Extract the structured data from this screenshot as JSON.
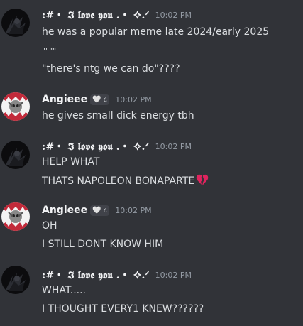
{
  "messages": [
    {
      "author": ":#・ 𝕴 𝖑𝖔𝖛𝖊 𝖞𝖔𝖚 .・ ✧.ᐟ",
      "time": "10:02 PM",
      "lines": [
        "he was a popular meme late 2024/early 2025",
        "\"\"\"\"",
        "\"there's ntg we can do\"????"
      ]
    },
    {
      "author": "Angieee",
      "badge": "🤍 ૮ ",
      "time": "10:02 PM",
      "lines": [
        "he gives small dick energy tbh"
      ]
    },
    {
      "author": ":#・ 𝕴 𝖑𝖔𝖛𝖊 𝖞𝖔𝖚 .・ ✧.ᐟ",
      "time": "10:02 PM",
      "lines": [
        "HELP WHAT",
        "THATS NAPOLEON BONAPARTE"
      ],
      "emoji": "broken-heart-icon"
    },
    {
      "author": "Angieee",
      "badge": "🤍 ૮ ",
      "time": "10:02 PM",
      "lines": [
        "OH",
        "I STILL DONT KNOW HIM"
      ]
    },
    {
      "author": ":#・ 𝕴 𝖑𝖔𝖛𝖊 𝖞𝖔𝖚 .・ ✧.ᐟ",
      "time": "10:02 PM",
      "lines": [
        "WHAT.....",
        "I THOUGHT EVERY1 KNEW??????"
      ]
    }
  ],
  "colors": {
    "background": "#313338",
    "text": "#dbdee1",
    "username": "#f2f3f5",
    "timestamp": "#949ba4",
    "broken_heart": "#e0245e"
  }
}
